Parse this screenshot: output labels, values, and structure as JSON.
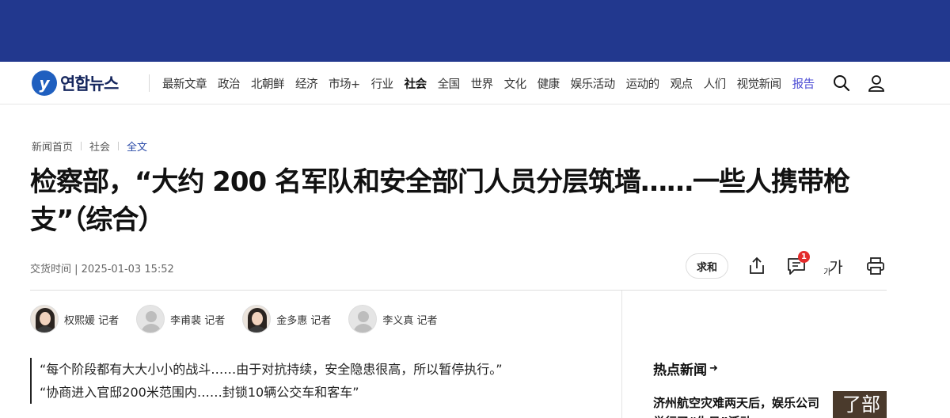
{
  "header": {
    "logo_text": "연합뉴스",
    "nav": [
      "最新文章",
      "政治",
      "北朝鲜",
      "经济",
      "市场+",
      "行业",
      "社会",
      "全国",
      "世界",
      "文化",
      "健康",
      "娱乐活动",
      "运动的",
      "观点",
      "人们",
      "视觉新闻",
      "报告"
    ],
    "active_nav": "社会"
  },
  "breadcrumb": [
    "新闻首页",
    "社会",
    "全文"
  ],
  "article": {
    "headline_line1": "检察部，“大约 200 名军队和安全部门人员分层筑墙……一些人携带枪",
    "headline_line2": "支”（综合）",
    "dateline": "交货时间 | 2025-01-03 15:52"
  },
  "actions": {
    "pill_label": "求和",
    "comment_count": "1",
    "font_size_glyph": "가",
    "font_size_small": "가"
  },
  "reporters": [
    {
      "name": "权熙媛 记者",
      "photo": true
    },
    {
      "name": "李甫裴 记者",
      "photo": false
    },
    {
      "name": "金多惠 记者",
      "photo": true
    },
    {
      "name": "李义真 记者",
      "photo": false
    }
  ],
  "summary": [
    "“每个阶段都有大大小小的战斗……由于对抗持续，安全隐患很高，所以暂停执行。”",
    "“协商进入官邸200米范围内……封锁10辆公交车和客车”"
  ],
  "sidebar": {
    "hot_news_title": "热点新闻",
    "hot_item": "济州航空灾难两天后，娱乐公司举行了“生日”活动",
    "thumb_text": "了部"
  },
  "colors": {
    "banner": "#22388e",
    "accent_link": "#2a4aa8",
    "badge": "#e32b2b"
  }
}
